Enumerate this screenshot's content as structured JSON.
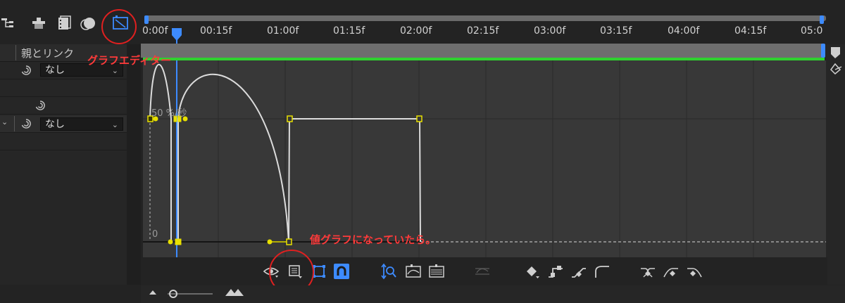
{
  "timeline": {
    "ticks": [
      "0:00f",
      "00:15f",
      "01:00f",
      "01:15f",
      "02:00f",
      "02:15f",
      "03:00f",
      "03:15f",
      "04:00f",
      "04:15f",
      "05:0"
    ]
  },
  "left_panel": {
    "header_label": "親とリンク",
    "rows": [
      {
        "dropdown": "なし"
      },
      {
        "dropdown": "なし"
      }
    ]
  },
  "graph": {
    "label_top": "50 %/秒",
    "label_zero": "0"
  },
  "annotations": {
    "graph_editor": "グラフエディター",
    "value_graph": "値グラフになっていたら。"
  },
  "colors": {
    "accent_blue": "#3d8bff",
    "keyframe_yellow": "#e8e000",
    "annotation_red": "#ff3a3a",
    "work_area_green": "#2fd12f"
  },
  "icons": [
    "flowchart-icon",
    "draft-3d-icon",
    "frame-blending-icon",
    "motion-blur-icon",
    "graph-editor-icon",
    "eye-icon",
    "graph-type-icon",
    "transform-box-icon",
    "snap-icon",
    "auto-zoom-height-icon",
    "fit-selection-icon",
    "fit-all-icon",
    "separate-dimensions-icon",
    "keyframe-interpolation-icon",
    "hold-icon",
    "linear-icon",
    "auto-bezier-icon",
    "easy-ease-icon",
    "easy-ease-in-icon",
    "easy-ease-out-icon"
  ]
}
